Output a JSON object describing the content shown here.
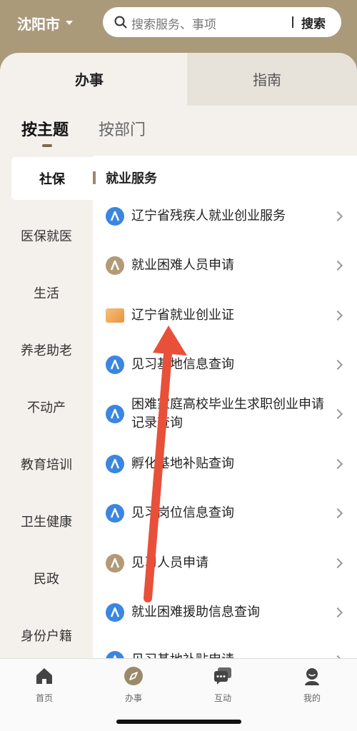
{
  "header": {
    "city": "沈阳市",
    "search": {
      "placeholder": "搜索服务、事项",
      "button_label": "搜索"
    }
  },
  "tabs": [
    {
      "label": "办事",
      "active": true
    },
    {
      "label": "指南",
      "active": false
    }
  ],
  "topic_tabs": [
    {
      "label": "按主题",
      "active": true
    },
    {
      "label": "按部门",
      "active": false
    }
  ],
  "sidebar": {
    "items": [
      {
        "label": "社保",
        "active": true
      },
      {
        "label": "医保就医"
      },
      {
        "label": "生活"
      },
      {
        "label": "养老助老"
      },
      {
        "label": "不动产"
      },
      {
        "label": "教育培训"
      },
      {
        "label": "卫生健康"
      },
      {
        "label": "民政"
      },
      {
        "label": "身份户籍"
      }
    ]
  },
  "content": {
    "section_title": "就业服务",
    "items": [
      {
        "label": "辽宁省残疾人就业创业服务",
        "icon": "blue-a-icon"
      },
      {
        "label": "就业困难人员申请",
        "icon": "gold-a-icon"
      },
      {
        "label": "辽宁省就业创业证",
        "icon": "card-icon"
      },
      {
        "label": "见习基地信息查询",
        "icon": "blue-a-icon"
      },
      {
        "label": "困难家庭高校毕业生求职创业申请记录查询",
        "icon": "blue-a-icon"
      },
      {
        "label": "孵化基地补贴查询",
        "icon": "blue-a-icon"
      },
      {
        "label": "见习岗位信息查询",
        "icon": "blue-a-icon"
      },
      {
        "label": "见习人员申请",
        "icon": "gold-a-icon"
      },
      {
        "label": "就业困难援助信息查询",
        "icon": "blue-a-icon"
      },
      {
        "label": "见习基地补贴申请",
        "icon": "blue-a-icon"
      }
    ]
  },
  "bottom_nav": [
    {
      "label": "首页",
      "icon": "home-icon"
    },
    {
      "label": "办事",
      "icon": "compass-icon",
      "active": true
    },
    {
      "label": "互动",
      "icon": "chat-icon"
    },
    {
      "label": "我的",
      "icon": "user-icon"
    }
  ],
  "colors": {
    "header_bg": "#aa9a7a",
    "accent": "#7b6a4e",
    "blue_icon": "#3b86e0",
    "gold_icon": "#b39a76",
    "annotation_arrow": "#e8503a"
  }
}
